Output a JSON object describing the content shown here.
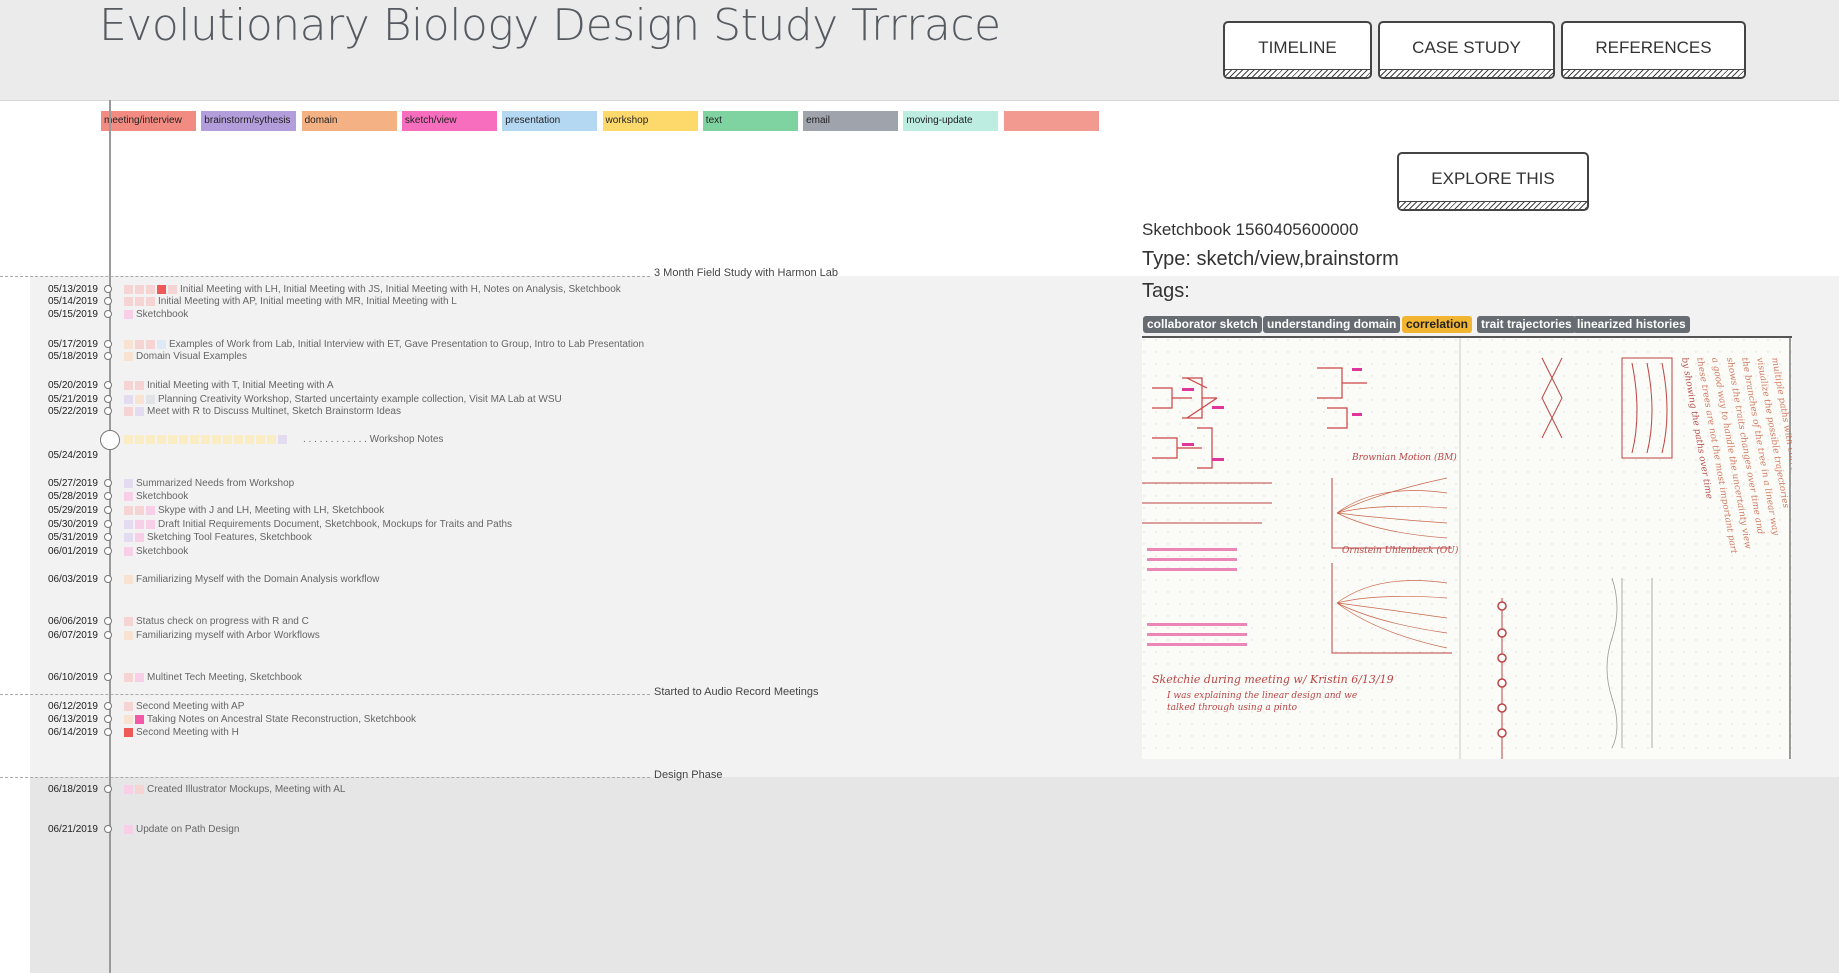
{
  "header": {
    "title": "Evolutionary Biology Design Study Trrrace",
    "nav": [
      {
        "label": "TIMELINE"
      },
      {
        "label": "CASE STUDY"
      },
      {
        "label": "REFERENCES"
      }
    ]
  },
  "legend": [
    {
      "label": "meeting/interview",
      "color": "#f28b82"
    },
    {
      "label": "brainstorm/sythesis",
      "color": "#b39ddb"
    },
    {
      "label": "domain",
      "color": "#f4b183"
    },
    {
      "label": "sketch/view",
      "color": "#f76ebf"
    },
    {
      "label": "presentation",
      "color": "#b5d8f2"
    },
    {
      "label": "workshop",
      "color": "#fcd96a"
    },
    {
      "label": "text",
      "color": "#7fd3a0"
    },
    {
      "label": "email",
      "color": "#9fa3ac"
    },
    {
      "label": "moving-update",
      "color": "#bdece0"
    },
    {
      "label": "",
      "color": "#f29a8f"
    }
  ],
  "phases": [
    {
      "label": "3 Month Field Study with Harmon Lab"
    },
    {
      "label": "Started to Audio Record Meetings"
    },
    {
      "label": "Design Phase"
    }
  ],
  "timeline": [
    {
      "date": "05/13/2019",
      "text": "Initial Meeting with LH, Initial Meeting with JS, Initial Meeting with H, Notes on Analysis, Sketchbook",
      "squares": [
        "#f7d4d4",
        "#f7d4d4",
        "#f7d4d4",
        "#ee5a5a",
        "#f7d4d4"
      ]
    },
    {
      "date": "05/14/2019",
      "text": "Initial Meeting with AP, Initial meeting with MR, Initial Meeting with L",
      "squares": [
        "#f7d4d4",
        "#f7d4d4",
        "#f7d4d4"
      ]
    },
    {
      "date": "05/15/2019",
      "text": "Sketchbook",
      "squares": [
        "#f7cfe6"
      ]
    },
    {
      "date": "05/17/2019",
      "text": "Examples of Work from Lab, Initial Interview with ET, Gave Presentation to Group, Intro to Lab Presentation",
      "squares": [
        "#f8e3d2",
        "#f7d4d4",
        "#f7d4d4",
        "#ddeaf6"
      ]
    },
    {
      "date": "05/18/2019",
      "text": "Domain Visual Examples",
      "squares": [
        "#f8e3d2"
      ]
    },
    {
      "date": "05/20/2019",
      "text": "Initial Meeting with T, Initial Meeting with A",
      "squares": [
        "#f7d4d4",
        "#f7d4d4"
      ]
    },
    {
      "date": "05/21/2019",
      "text": "Planning Creativity Workshop, Started uncertainty example collection, Visit MA Lab at WSU",
      "squares": [
        "#e3dbef",
        "#f8e3d2",
        "#e1e3e6"
      ]
    },
    {
      "date": "05/22/2019",
      "text": "Meet with R to Discuss Multinet, Sketch Brainstorm Ideas",
      "squares": [
        "#f7d4d4",
        "#e3dbef"
      ]
    },
    {
      "date": "05/24/2019",
      "text": ". . . . . . . . . . . .  Workshop Notes",
      "squares": []
    },
    {
      "date": "05/27/2019",
      "text": "Summarized Needs from Workshop",
      "squares": [
        "#e3dbef"
      ]
    },
    {
      "date": "05/28/2019",
      "text": "Sketchbook",
      "squares": [
        "#f7cfe6"
      ]
    },
    {
      "date": "05/29/2019",
      "text": "Skype with J and LH, Meeting with LH, Sketchbook",
      "squares": [
        "#f7d4d4",
        "#f7d4d4",
        "#f7cfe6"
      ]
    },
    {
      "date": "05/30/2019",
      "text": "Draft Initial Requirements Document, Sketchbook, Mockups for Traits and Paths",
      "squares": [
        "#e3dbef",
        "#f7cfe6",
        "#f7cfe6"
      ]
    },
    {
      "date": "05/31/2019",
      "text": "Sketching Tool Features, Sketchbook",
      "squares": [
        "#e3dbef",
        "#f7cfe6"
      ]
    },
    {
      "date": "06/01/2019",
      "text": "Sketchbook",
      "squares": [
        "#f7cfe6"
      ]
    },
    {
      "date": "06/03/2019",
      "text": "Familiarizing Myself with the Domain Analysis workflow",
      "squares": [
        "#f8e3d2"
      ]
    },
    {
      "date": "06/06/2019",
      "text": "Status check on progress with R and C",
      "squares": [
        "#f7d4d4"
      ]
    },
    {
      "date": "06/07/2019",
      "text": "Familiarizing myself with Arbor Workflows",
      "squares": [
        "#f8e3d2"
      ]
    },
    {
      "date": "06/10/2019",
      "text": "Multinet Tech Meeting, Sketchbook",
      "squares": [
        "#f7d4d4",
        "#f7cfe6"
      ]
    },
    {
      "date": "06/12/2019",
      "text": "Second Meeting with AP",
      "squares": [
        "#f7d4d4"
      ]
    },
    {
      "date": "06/13/2019",
      "text": "Taking Notes on Ancestral State Reconstruction, Sketchbook",
      "squares": [
        "#f8e3d2",
        "#f25aa8"
      ]
    },
    {
      "date": "06/14/2019",
      "text": "Second Meeting with H",
      "squares": [
        "#ee5a5a"
      ]
    },
    {
      "date": "06/18/2019",
      "text": "Created Illustrator Mockups, Meeting with AL",
      "squares": [
        "#f7cfe6",
        "#f7d4d4"
      ]
    },
    {
      "date": "06/21/2019",
      "text": "Update on Path Design",
      "squares": [
        "#f7cfe6"
      ]
    }
  ],
  "workshop_squares": [
    "#faedc4",
    "#faedc4",
    "#faedc4",
    "#faedc4",
    "#faedc4",
    "#faedc4",
    "#faedc4",
    "#faedc4",
    "#faedc4",
    "#faedc4",
    "#faedc4",
    "#faedc4",
    "#faedc4",
    "#faedc4",
    "#e3dbef"
  ],
  "detail": {
    "explore_label": "EXPLORE THIS",
    "title": "Sketchbook 1560405600000",
    "type": "Type: sketch/view,brainstorm",
    "tags_label": "Tags:",
    "tags": [
      {
        "label": "collaborator sketch",
        "highlight": false
      },
      {
        "label": "understanding domain",
        "highlight": false
      },
      {
        "label": "correlation",
        "highlight": true
      },
      {
        "label": "trait trajectories",
        "highlight": false
      },
      {
        "label": "linearized histories",
        "highlight": false
      }
    ]
  }
}
